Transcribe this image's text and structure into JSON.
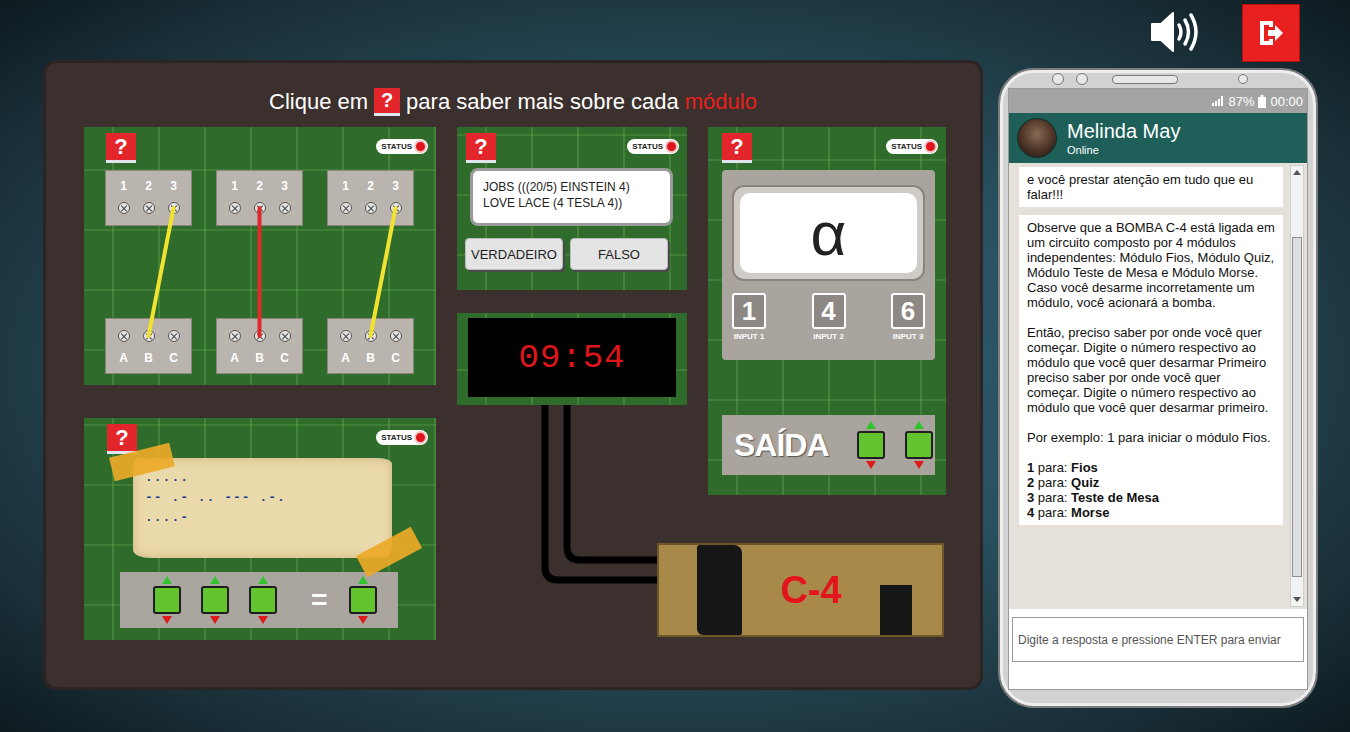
{
  "sound": {
    "on": true
  },
  "board": {
    "title": {
      "before": "Clique em",
      "icon": "?",
      "after": "para saber mais sobre cada",
      "highlight": "módulo"
    }
  },
  "modules": {
    "fios": {
      "help": "?",
      "status": "STATUS",
      "top_plates": [
        {
          "pins": [
            "1",
            "2",
            "3"
          ]
        },
        {
          "pins": [
            "1",
            "2",
            "3"
          ]
        },
        {
          "pins": [
            "1",
            "2",
            "3"
          ]
        }
      ],
      "bottom_plates": [
        {
          "pins": [
            "A",
            "B",
            "C"
          ]
        },
        {
          "pins": [
            "A",
            "B",
            "C"
          ]
        },
        {
          "pins": [
            "A",
            "B",
            "C"
          ]
        }
      ],
      "wires": [
        {
          "from": {
            "plate": 1,
            "pin": "3"
          },
          "to": {
            "plate": 1,
            "pin": "B"
          },
          "color": "#f2e230"
        },
        {
          "from": {
            "plate": 2,
            "pin": "2"
          },
          "to": {
            "plate": 2,
            "pin": "B"
          },
          "color": "#e02a2a"
        },
        {
          "from": {
            "plate": 3,
            "pin": "3"
          },
          "to": {
            "plate": 3,
            "pin": "B"
          },
          "color": "#f2e230"
        }
      ]
    },
    "quiz": {
      "help": "?",
      "status": "STATUS",
      "question": "JOBS (((20/5) EINSTEIN 4) LOVE LACE (4 TESLA 4))",
      "buttons": [
        "VERDADEIRO",
        "FALSO"
      ]
    },
    "timer": {
      "time": "09:54"
    },
    "teste_de_mesa": {
      "help": "?",
      "status": "STATUS",
      "symbol": "α",
      "inputs": [
        {
          "value": "1",
          "label": "INPUT 1"
        },
        {
          "value": "4",
          "label": "INPUT 2"
        },
        {
          "value": "6",
          "label": "INPUT 3"
        }
      ],
      "output": {
        "label": "SAÍDA",
        "switch_count": 2
      }
    },
    "morse": {
      "help": "?",
      "status": "STATUS",
      "lines": [
        ".....",
        "-- .- .. --- .-.",
        "....-"
      ],
      "equals": "=",
      "input_count": 3,
      "result_count": 1
    }
  },
  "bomb": {
    "label": "C-4"
  },
  "phone": {
    "battery": "87%",
    "clock": "00:00",
    "contact": {
      "name": "Melinda May",
      "status": "Online"
    },
    "messages": [
      {
        "paragraphs": [
          "e você prestar atenção em tudo que eu falar!!!"
        ],
        "options": []
      },
      {
        "paragraphs": [
          "Observe que a BOMBA C-4 está ligada em um circuito composto por 4 módulos independentes: Módulo Fios, Módulo Quiz, Módulo Teste de Mesa e Módulo Morse. Caso você desarme incorretamente um módulo, você acionará a bomba.",
          "Então, preciso saber por onde você quer começar. Digite o número respectivo ao módulo que você quer desarmar Primeiro preciso saber por onde você quer começar. Digite o número respectivo ao módulo que você quer desarmar primeiro.",
          "Por exemplo: 1 para iniciar o módulo Fios."
        ],
        "options": [
          {
            "number": "1",
            "label": "para:",
            "name": "Fios"
          },
          {
            "number": "2",
            "label": "para:",
            "name": "Quiz"
          },
          {
            "number": "3",
            "label": "para:",
            "name": "Teste de Mesa"
          },
          {
            "number": "4",
            "label": "para:",
            "name": "Morse"
          }
        ]
      }
    ],
    "input_placeholder": "Digite a resposta e pressione ENTER para enviar"
  }
}
